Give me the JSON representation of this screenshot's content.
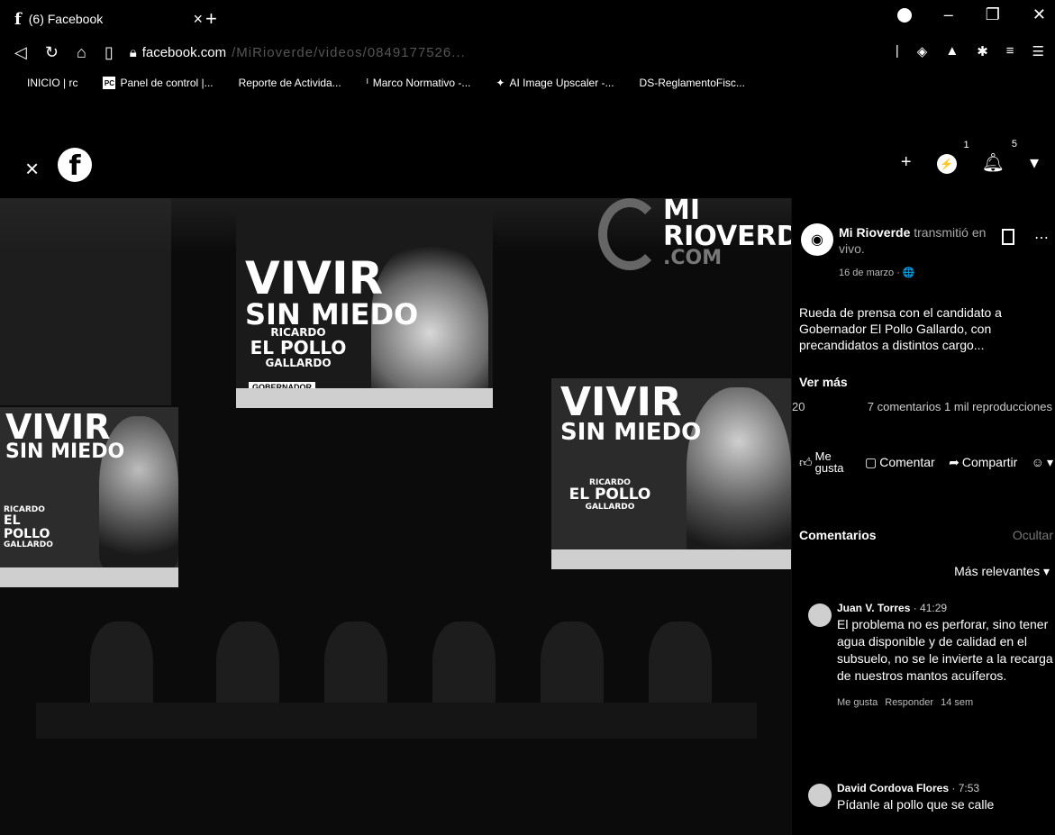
{
  "browser": {
    "tab_title": "(6) Facebook",
    "tab_favicon": "f",
    "url_domain": "facebook.com",
    "url_path": "/MiRioverde/videos/0849177526..."
  },
  "bookmarks": [
    {
      "label": "INICIO | rc",
      "icon": ""
    },
    {
      "label": "Panel de control |...",
      "icon": "PC"
    },
    {
      "label": "Reporte de Activida...",
      "icon": ""
    },
    {
      "label": "Marco Normativo -...",
      "icon": "ᴵ"
    },
    {
      "label": "AI Image Upscaler -...",
      "icon": "✦"
    },
    {
      "label": "DS-ReglamentoFisc...",
      "icon": ""
    }
  ],
  "fb_header": {
    "logo": "f",
    "messenger_badge": "1",
    "notifications_badge": "5"
  },
  "video": {
    "banners": [
      {
        "slogan_1": "VIVIR",
        "slogan_2": "SIN MIEDO",
        "name_1": "RICARDO",
        "name_2": "EL POLLO",
        "name_3": "GALLARDO",
        "tag": "GOBERNADOR"
      },
      {
        "slogan_1": "VIVIR",
        "slogan_2": "SIN MIEDO",
        "name_1": "RICARDO",
        "name_2": "EL POLLO",
        "name_3": "GALLARDO"
      },
      {
        "slogan_1": "VIVIR",
        "slogan_2": "SIN MIEDO",
        "name_1": "RICARDO",
        "name_2": "EL POLLO",
        "name_3": "GALLARDO"
      }
    ],
    "watermark_1": "MI",
    "watermark_2": "RIOVERDE",
    "watermark_3": ".COM"
  },
  "post": {
    "author": "Mi Rioverde",
    "author_desc": "transmitió en vivo.",
    "date": "16 de marzo · 🌐",
    "text": "Rueda de prensa con el candidato a Gobernador El Pollo Gallardo, con precandidatos a distintos cargo...",
    "see_more": "Ver más",
    "reactions_count": "20",
    "stats": "7 comentarios  1 mil reproducciones",
    "like_label": "Me gusta",
    "comment_label": "Comentar",
    "share_label": "Compartir"
  },
  "comments_section": {
    "title": "Comentarios",
    "hide": "Ocultar",
    "sort": "Más relevantes ▾",
    "items": [
      {
        "author": "Juan V. Torres",
        "time": "· 41:29",
        "text": "El problema no es perforar, sino tener agua disponible y de calidad en el subsuelo, no se le invierte a la recarga de nuestros mantos acuíferos.",
        "like": "Me gusta",
        "reply": "Responder",
        "age": "14 sem"
      },
      {
        "author": "David Cordova Flores",
        "time": "· 7:53",
        "text": "Pídanle al pollo que se calle"
      }
    ]
  }
}
